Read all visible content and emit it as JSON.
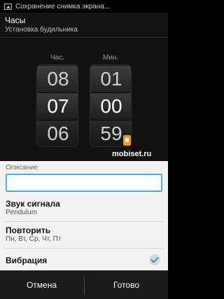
{
  "statusbar": {
    "notification": "Сохранение снимка экрана..."
  },
  "actionbar": {
    "title": "Часы",
    "subtitle": "Установка будильника"
  },
  "picker": {
    "hours_label": "Час.",
    "minutes_label": "Мин.",
    "hours": {
      "prev": "08",
      "current": "07",
      "next": "06"
    },
    "minutes": {
      "prev": "01",
      "current": "00",
      "next": "59"
    }
  },
  "watermark": "mobiset.ru",
  "form": {
    "description_label": "Описание",
    "description_value": "",
    "sound_title": "Звук сигнала",
    "sound_value": "Pendulum",
    "repeat_title": "Повторить",
    "repeat_value": "Пн, Вт, Ср, Чт, Пт",
    "vibration_title": "Вибрация",
    "vibration_checked": true
  },
  "buttons": {
    "cancel": "Отмена",
    "done": "Готово"
  }
}
